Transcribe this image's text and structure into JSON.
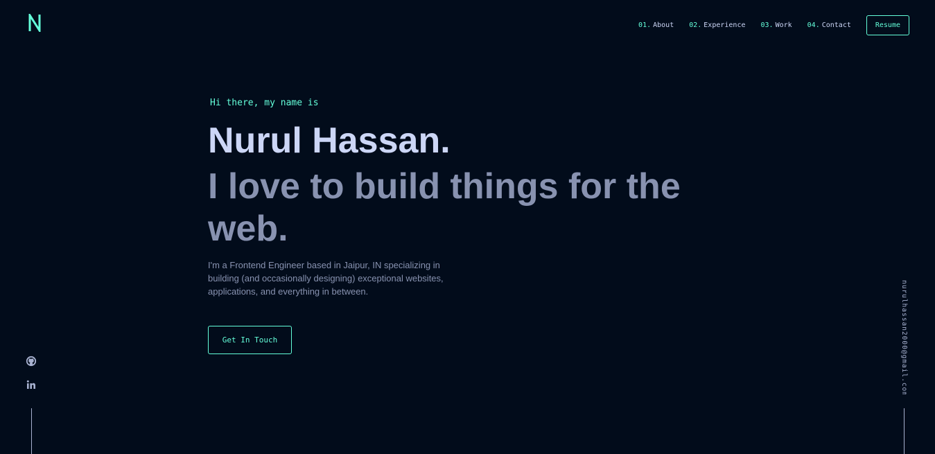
{
  "brand": {
    "logo_letter": "N",
    "logo_icon": "logo-n-icon",
    "accent_color": "#64ffda",
    "background_color": "#020c1b"
  },
  "nav": {
    "items": [
      {
        "num": "01.",
        "label": "About"
      },
      {
        "num": "02.",
        "label": "Experience"
      },
      {
        "num": "03.",
        "label": "Work"
      },
      {
        "num": "04.",
        "label": "Contact"
      }
    ],
    "resume_label": "Resume"
  },
  "hero": {
    "greeting": "Hi there, my name is",
    "name": "Nurul Hassan.",
    "tagline": "I love to build things for the web.",
    "bio": "I'm a Frontend Engineer based in Jaipur, IN specializing in building (and occasionally designing) exceptional websites, applications, and everything in between.",
    "cta_label": "Get In Touch"
  },
  "social": {
    "icons": [
      "github-icon",
      "linkedin-icon"
    ]
  },
  "email": "nurulhassan2000@gmail.com"
}
